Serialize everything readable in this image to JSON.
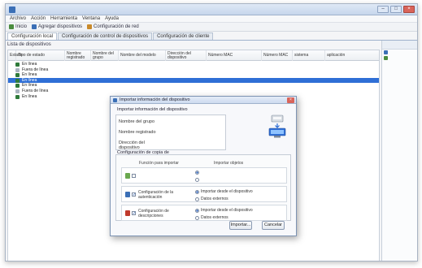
{
  "window": {
    "title": "",
    "controls": {
      "minimize": "–",
      "maximize": "□",
      "close": "×"
    }
  },
  "menubar": {
    "items": [
      "Archivo",
      "Acción",
      "Herramienta",
      "Ventana",
      "Ayuda"
    ]
  },
  "toolbar": {
    "items": [
      {
        "label": "Inicio",
        "icon": "home-icon",
        "color": "#4a8c3f"
      },
      {
        "label": "Agregar dispositivos",
        "icon": "add-device-icon",
        "color": "#3b6fb6"
      },
      {
        "label": "Configuración de red",
        "icon": "network-config-icon",
        "color": "#c98a2a"
      }
    ]
  },
  "tabs": [
    {
      "label": "Configuración local",
      "active": true
    },
    {
      "label": "Configuración de control de dispositivos",
      "active": false
    },
    {
      "label": "Configuración de cliente",
      "active": false
    }
  ],
  "content": {
    "list_title": "Lista de dispositivos",
    "count_label": ""
  },
  "grid": {
    "columns": [
      "Estado",
      "Tipo de estado",
      "Nombre registrado",
      "Nombre del grupo",
      "Nombre del modelo",
      "Dirección del dispositivo",
      "Número MAC",
      "Número MAC",
      "sistema",
      "aplicación"
    ],
    "rows": [
      {
        "icon_color": "#2f7b3a",
        "selected": false,
        "cells": [
          "",
          "En línea",
          "",
          "",
          "",
          "",
          "",
          "",
          "",
          ""
        ]
      },
      {
        "icon_color": "#aab4c0",
        "selected": false,
        "cells": [
          "",
          "Fuera de línea",
          "",
          "",
          "",
          "",
          "",
          "",
          "",
          ""
        ]
      },
      {
        "icon_color": "#2f7b3a",
        "selected": false,
        "cells": [
          "",
          "En línea",
          "",
          "",
          "",
          "",
          "",
          "",
          "",
          ""
        ]
      },
      {
        "icon_color": "#2f7b3a",
        "selected": true,
        "cells": [
          "",
          "En línea",
          "",
          "",
          "",
          "",
          "",
          "",
          "",
          ""
        ]
      },
      {
        "icon_color": "#2f7b3a",
        "selected": false,
        "cells": [
          "",
          "En línea",
          "",
          "",
          "",
          "",
          "",
          "",
          "",
          ""
        ]
      },
      {
        "icon_color": "#aab4c0",
        "selected": false,
        "cells": [
          "",
          "Fuera de línea",
          "",
          "",
          "",
          "",
          "",
          "",
          "",
          ""
        ]
      },
      {
        "icon_color": "#2f7b3a",
        "selected": false,
        "cells": [
          "",
          "En línea",
          "",
          "",
          "",
          "",
          "",
          "",
          "",
          ""
        ]
      }
    ]
  },
  "sidepanel": {
    "title": "",
    "items": [
      {
        "label": "",
        "icon": "wrench-icon",
        "color": "#3b6fb6"
      },
      {
        "label": "",
        "icon": "gear-icon",
        "color": "#4a8c3f"
      },
      {
        "label": "",
        "icon": "",
        "color": ""
      }
    ],
    "sub_label": ""
  },
  "dialog": {
    "title": "Importar información del dispositivo",
    "close": "×",
    "info_title": "Importar información del dispositivo",
    "info": [
      {
        "label": "Nombre del grupo",
        "value": ""
      },
      {
        "label": "Nombre registrado",
        "value": ""
      },
      {
        "label": "Dirección del dispositivo",
        "value": ""
      }
    ],
    "config_title": "Configuración de copia de",
    "col_import": "Función para importar",
    "col_object": "Importar objetos",
    "sections": [
      {
        "label": "",
        "icon": "card-icon",
        "icon_color": "#6aa84f",
        "checked": false,
        "disabled": true,
        "options": [
          {
            "label": "",
            "on": true
          },
          {
            "label": "",
            "on": false
          }
        ]
      },
      {
        "label": "Configuración de la autenticación",
        "icon": "auth-icon",
        "icon_color": "#3b6fb6",
        "checked": true,
        "disabled": false,
        "options": [
          {
            "label": "Importar desde el dispositivo",
            "on": true
          },
          {
            "label": "Datos externos",
            "on": false
          }
        ]
      },
      {
        "label": "Configuración de descripciones",
        "icon": "description-icon",
        "icon_color": "#c0392b",
        "checked": true,
        "disabled": false,
        "options": [
          {
            "label": "Importar desde el dispositivo",
            "on": true
          },
          {
            "label": "Datos externos",
            "on": false
          }
        ]
      }
    ],
    "help": "",
    "ok": "Importar...",
    "cancel": "Cancelar"
  }
}
